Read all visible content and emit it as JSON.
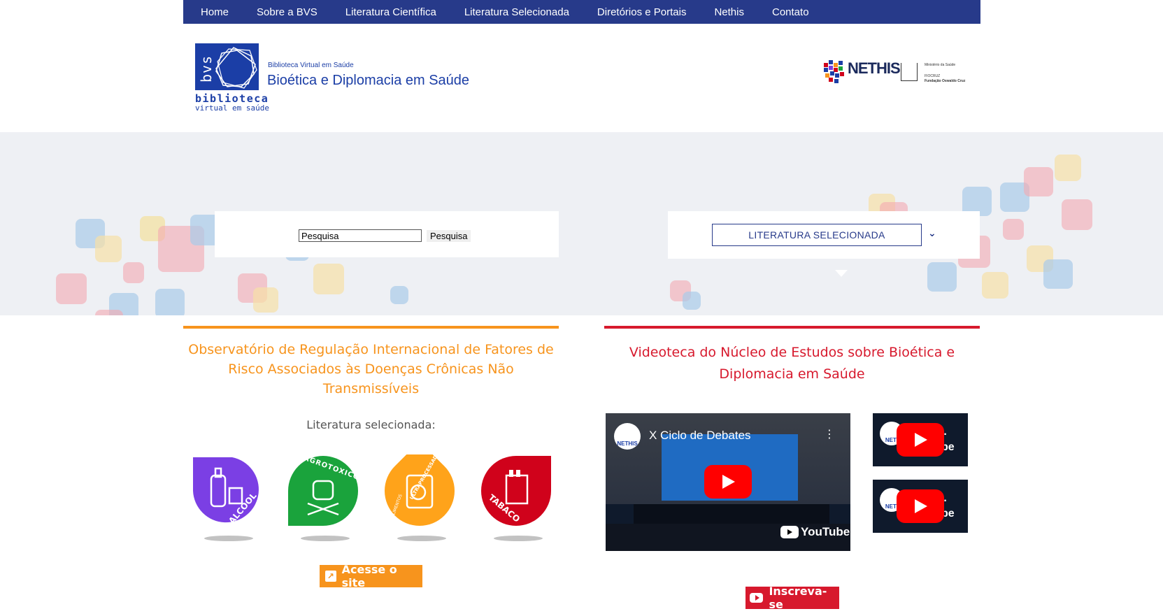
{
  "nav": {
    "items": [
      "Home",
      "Sobre a BVS",
      "Literatura Científica",
      "Literatura Selecionada",
      "Diretórios e Portais",
      "Nethis",
      "Contato"
    ]
  },
  "header": {
    "logo_bvs": "bvs",
    "logo_biblioteca": "biblioteca",
    "logo_virtual": "virtual em saúde",
    "site_small": "Biblioteca Virtual em Saúde",
    "site_title": "Bioética e Diplomacia em Saúde",
    "partner_nethis": "NETHIS",
    "partner_ministerio": "Ministério da Saúde",
    "partner_fiocruz": "FIOCRUZ",
    "partner_fiocruz_full": "Fundação Oswaldo Cruz"
  },
  "search": {
    "input_value": "Pesquisa",
    "button_label": "Pesquisa"
  },
  "select": {
    "selected": "LITERATURA SELECIONADA"
  },
  "observatorio": {
    "title": "Observatório de Regulação Internacional de Fatores de Risco Associados às Doenças Crônicas Não Transmissíveis",
    "subtitle": "Literatura selecionada:",
    "badges": [
      {
        "label": "ALCOOL",
        "color": "#7b3fe4"
      },
      {
        "label": "AGROTOXICO",
        "color": "#1aa33c"
      },
      {
        "label": "ULTRAPROCESSADOS",
        "color": "#ffa31a"
      },
      {
        "label": "TABACO",
        "color": "#d0021b"
      }
    ],
    "badge_upper": "ALIMENTOS",
    "cta": "Acesse o site"
  },
  "videoteca": {
    "title": "Videoteca do Núcleo de Estudos sobre Bioética e Diplomacia em Saúde",
    "main_video_title": "X Ciclo de Debates",
    "channel_avatar": "NETHIS",
    "youtube_label": "YouTube",
    "thumb_title": "l...",
    "thumb_suffix": "be",
    "thumb_avatar": "NETI",
    "subscribe": "Inscreva-se"
  },
  "colors": {
    "nav_bg": "#273a8a",
    "brand_blue": "#1b3ea6",
    "orange": "#f7941d",
    "red": "#d7192d"
  }
}
